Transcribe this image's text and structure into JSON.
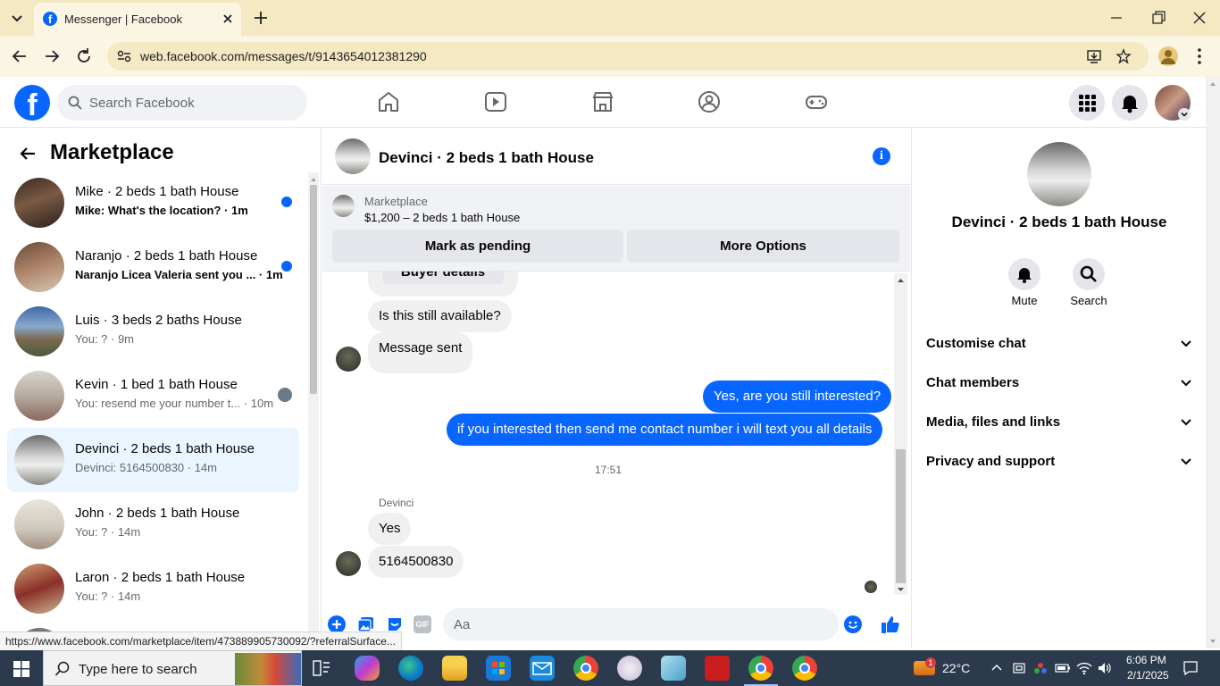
{
  "browser": {
    "tab_title": "Messenger | Facebook",
    "url": "web.facebook.com/messages/t/9143654012381290",
    "status_url": "https://www.facebook.com/marketplace/item/473889905730092/?referralSurface..."
  },
  "fb_header": {
    "search_placeholder": "Search Facebook"
  },
  "left": {
    "title": "Marketplace",
    "conversations": [
      {
        "name": "Mike · 2 beds 1 bath House",
        "snippet": "Mike: What's the location? · 1m",
        "unread": true
      },
      {
        "name": "Naranjo · 2 beds 1 bath House",
        "snippet": "Naranjo Licea Valeria sent you ... · 1m",
        "unread": true
      },
      {
        "name": "Luis · 3 beds 2 baths House",
        "snippet": "You: ? · 9m",
        "unread": false
      },
      {
        "name": "Kevin · 1 bed 1 bath House",
        "snippet": "You: resend me your number t... · 10m",
        "unread": false
      },
      {
        "name": "Devinci · 2 beds 1 bath House",
        "snippet": "Devinci: 5164500830 · 14m",
        "unread": false
      },
      {
        "name": "John · 2 beds 1 bath House",
        "snippet": "You: ? · 14m",
        "unread": false
      },
      {
        "name": "Laron · 2 beds 1 bath House",
        "snippet": "You: ? · 14m",
        "unread": false
      }
    ]
  },
  "chat": {
    "title": "Devinci · 2 beds 1 bath House",
    "marketplace_label": "Marketplace",
    "listing": "$1,200 – 2 beds 1 bath House",
    "mark_pending": "Mark as pending",
    "more_options": "More Options",
    "messages": {
      "buyer_details": "Buyer details",
      "still_available": "Is this still available?",
      "message_sent": "Message sent",
      "out1": "Yes, are you still interested?",
      "out2": "if you interested then send me contact number i will text you all details",
      "time": "17:51",
      "sender": "Devinci",
      "in1": "Yes",
      "in2": "5164500830"
    },
    "composer_placeholder": "Aa"
  },
  "right": {
    "title": "Devinci · 2 beds 1 bath House",
    "mute": "Mute",
    "search": "Search",
    "sections": [
      "Customise chat",
      "Chat members",
      "Media, files and links",
      "Privacy and support"
    ]
  },
  "taskbar": {
    "search_placeholder": "Type here to search",
    "temperature": "22°C",
    "time": "6:06 PM",
    "date": "2/1/2025",
    "weather_badge": "1"
  },
  "colors": {
    "fb_blue": "#0866ff",
    "chrome_bar": "#f4e9c2",
    "taskbar": "#2b3a4c"
  }
}
